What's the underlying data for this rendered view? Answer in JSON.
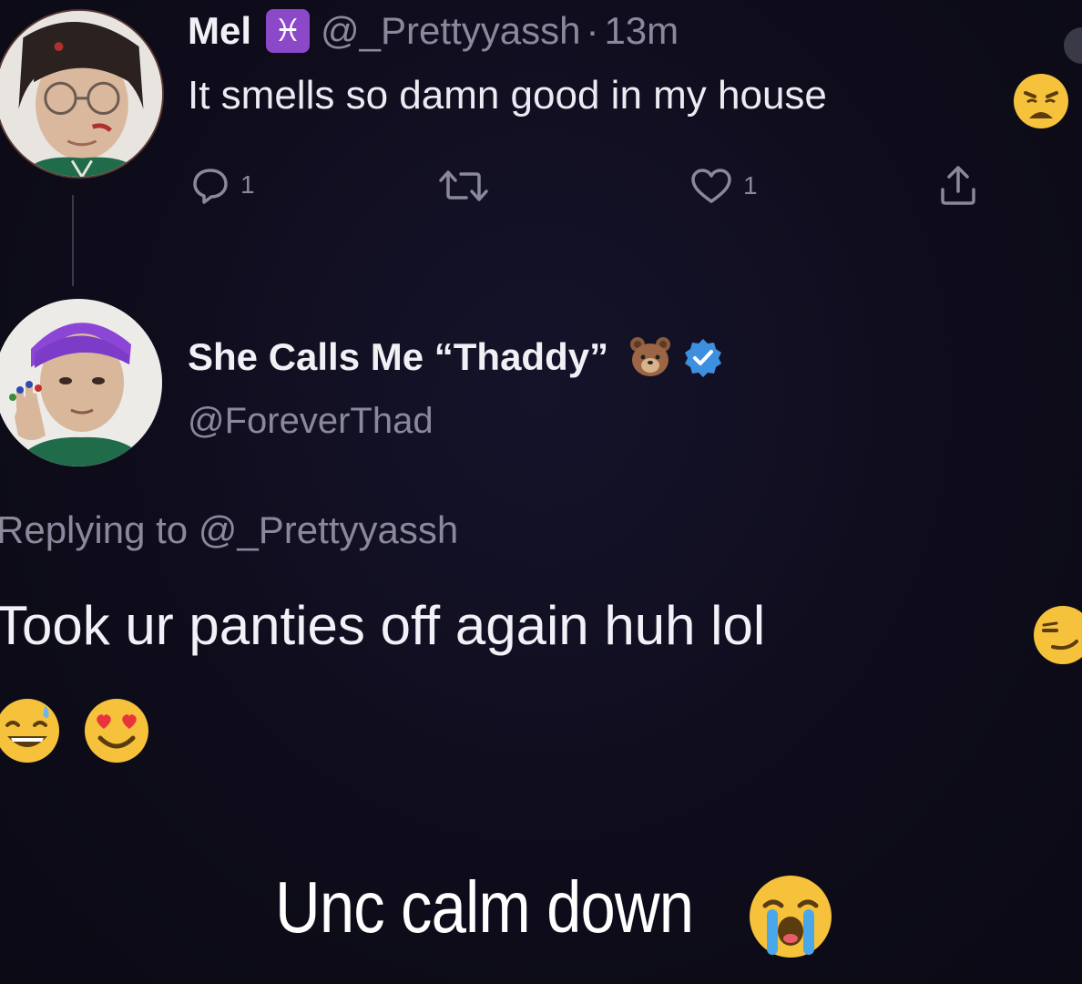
{
  "colors": {
    "background": "#0f0d1c",
    "text_primary": "#ecebf2",
    "text_secondary": "#8a889a",
    "pisces_badge": "#8b48c9",
    "verified_badge": "#3d8fe0",
    "thread_line": "#3b3a48"
  },
  "parent_tweet": {
    "display_name": "Mel",
    "badge_icon": "pisces-sign",
    "badge_glyph": "♓",
    "handle": "@_Prettyyassh",
    "separator": "·",
    "time": "13m",
    "text": "It smells so damn good in my house",
    "text_emoji": "weary-face",
    "actions": {
      "reply_icon": "reply-icon",
      "reply_count": "1",
      "retweet_icon": "retweet-icon",
      "like_icon": "heart-icon",
      "like_count": "1",
      "share_icon": "share-icon"
    }
  },
  "reply_tweet": {
    "display_name": "She Calls Me “Thaddy”",
    "name_emoji": "bear-face",
    "verified_icon": "verified-badge-icon",
    "handle": "@ForeverThad",
    "replying_to_label": "Replying to",
    "replying_to_handle": "@_Prettyyassh",
    "text": "Took ur panties off again huh lol",
    "text_emojis": [
      "smirking-face",
      "grinning-face-with-sweat",
      "smiling-face-with-heart-eyes"
    ]
  },
  "caption": {
    "text": "Unc calm down",
    "emoji": "loudly-crying-face"
  }
}
